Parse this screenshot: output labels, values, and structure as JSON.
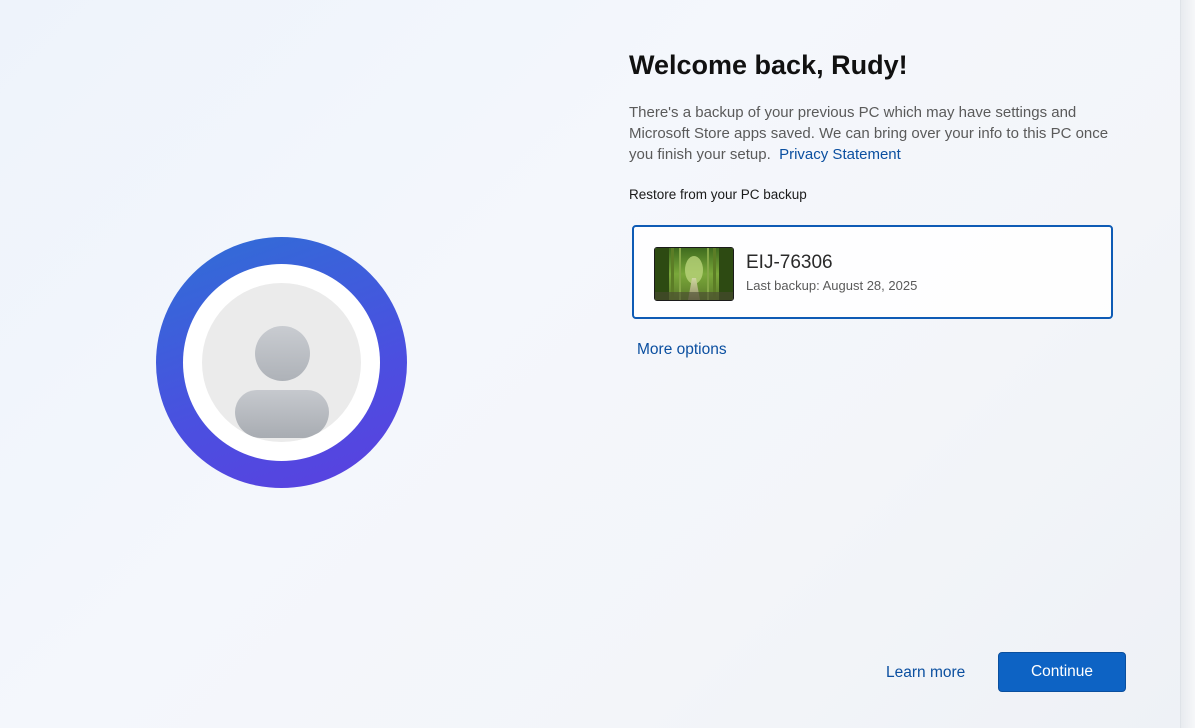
{
  "welcome": {
    "heading": "Welcome back, Rudy!",
    "description": "There's a backup of your previous PC which may have settings and Microsoft Store apps saved. We can bring over your info to this PC once you finish your setup.",
    "privacy_link": "Privacy Statement"
  },
  "restore": {
    "section_label": "Restore from your PC backup",
    "backup": {
      "device_name": "EIJ-76306",
      "last_backup": "Last backup: August 28, 2025",
      "thumbnail_icon": "bamboo-forest-thumbnail"
    },
    "more_options": "More options"
  },
  "footer": {
    "learn_more": "Learn more",
    "continue": "Continue"
  },
  "avatar": {
    "icon": "user-avatar-icon"
  },
  "colors": {
    "accent": "#0d63c4",
    "link": "#0b4fa0",
    "ring_start": "#2f6fd6",
    "ring_end": "#5b3fe0"
  }
}
